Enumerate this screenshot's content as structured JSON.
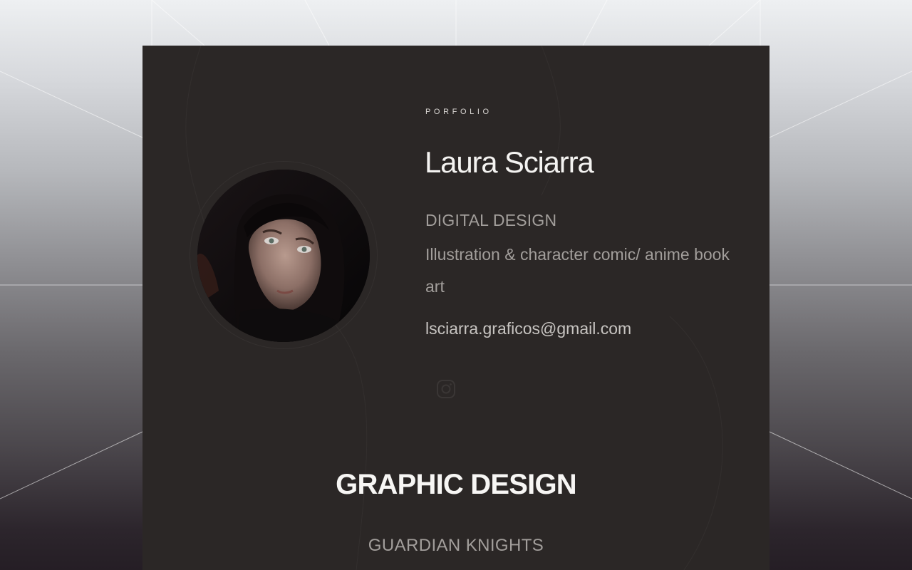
{
  "profile": {
    "eyebrow": "PORFOLIO",
    "name": "Laura Sciarra",
    "role": "DIGITAL DESIGN",
    "description": "Illustration & character comic/ anime book art",
    "email": "lsciarra.graficos@gmail.com",
    "avatar_alt": "Laura Sciarra",
    "social": [
      {
        "icon": "instagram-icon"
      }
    ]
  },
  "sections": [
    {
      "title": "GRAPHIC DESIGN",
      "projects": [
        {
          "title": "GUARDIAN KNIGHTS"
        }
      ]
    }
  ],
  "colors": {
    "card": "#2b2726",
    "text_primary": "#f4f3f1",
    "text_secondary": "#a29e9b"
  }
}
